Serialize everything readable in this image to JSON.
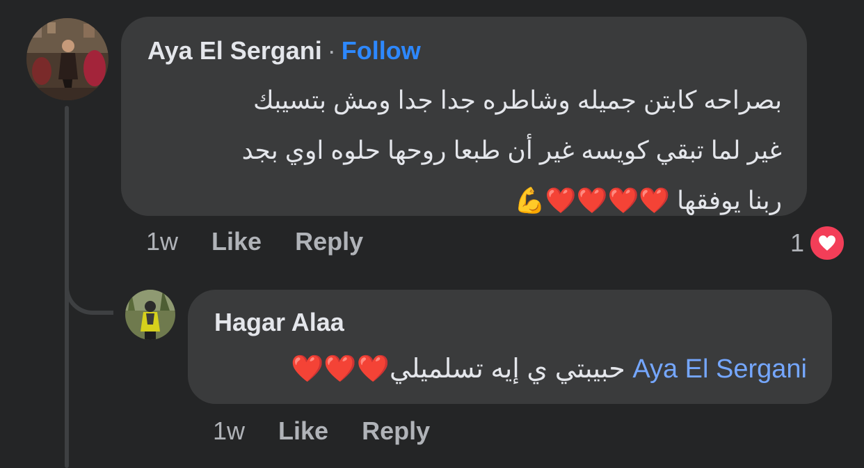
{
  "comment": {
    "author": "Aya El Sergani",
    "separator": "·",
    "follow_label": "Follow",
    "text_lines": [
      "بصراحه كابتن جميله وشاطره جدا جدا ومش بتسيبك",
      "غير لما تبقي كويسه غير أن طبعا روحها حلوه اوي بجد",
      "ربنا يوفقها ❤️❤️❤️❤️💪"
    ],
    "age": "1w",
    "like_label": "Like",
    "reply_label": "Reply",
    "reaction_count": "1",
    "reaction_icon": "heart-icon",
    "reaction_color": "#f33e58"
  },
  "reply": {
    "author": "Hagar Alaa",
    "mention": "Aya El Sergani",
    "text": "حبيبتي ي إيه تسلميلي❤️❤️❤️",
    "age": "1w",
    "like_label": "Like",
    "reply_label": "Reply"
  },
  "colors": {
    "background": "#242526",
    "bubble": "#3a3b3c",
    "follow": "#2d88ff",
    "mention": "#75a7ff",
    "secondary_text": "#b0b3b8"
  }
}
